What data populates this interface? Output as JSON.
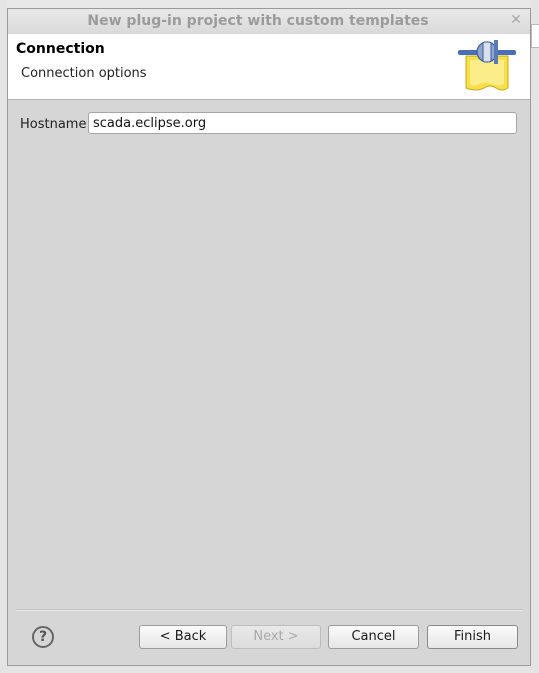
{
  "dialog": {
    "title": "New plug-in project with custom templates",
    "close_symbol": "✕"
  },
  "banner": {
    "title": "Connection",
    "subtitle": "Connection options",
    "icon": "plug-wizard-icon"
  },
  "form": {
    "hostname_label": "Hostname",
    "hostname_value": "scada.eclipse.org"
  },
  "footer": {
    "help_symbol": "?",
    "back_label": "< Back",
    "next_label": "Next >",
    "cancel_label": "Cancel",
    "finish_label": "Finish"
  },
  "colors": {
    "dialog_bg": "#d6d6d6",
    "banner_bg": "#ffffff",
    "disabled_text": "#a9a9a9"
  }
}
